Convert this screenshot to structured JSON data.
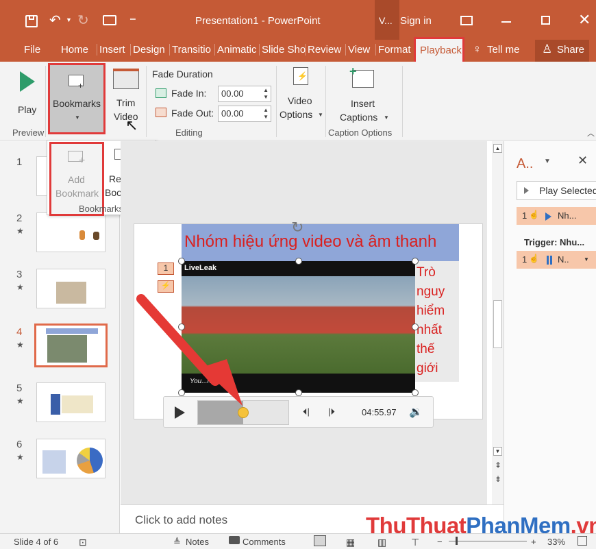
{
  "title_bar": {
    "doc_title": "Presentation1 - PowerPoint",
    "context_tab": "V...",
    "sign_in": "Sign in"
  },
  "tabs": [
    "File",
    "Home",
    "Insert",
    "Design",
    "Transitio",
    "Animatic",
    "Slide Sho",
    "Review",
    "View",
    "Format",
    "Playback"
  ],
  "tell_me": "Tell me",
  "share": "Share",
  "ribbon": {
    "preview": {
      "play_label": "Play",
      "group_label": "Preview"
    },
    "bookmarks_label": "Bookmarks",
    "trim": {
      "line1": "Trim",
      "line2": "Video"
    },
    "editing": {
      "fade_duration": "Fade Duration",
      "fade_in_label": "Fade In:",
      "fade_in_value": "00.00",
      "fade_out_label": "Fade Out:",
      "fade_out_value": "00.00",
      "group_label": "Editing"
    },
    "video_options": {
      "line1": "Video",
      "line2": "Options"
    },
    "insert_captions": {
      "line1": "Insert",
      "line2": "Captions"
    },
    "caption_group_label": "Caption Options"
  },
  "bookmark_menu": {
    "add_line1": "Add",
    "add_line2": "Bookmark",
    "remove_line1": "Remove",
    "remove_line2": "Bookmark",
    "group_label": "Bookmarks"
  },
  "slides": [
    {
      "num": "1",
      "star": ""
    },
    {
      "num": "2",
      "star": "★"
    },
    {
      "num": "3",
      "star": "★"
    },
    {
      "num": "4",
      "star": "★"
    },
    {
      "num": "5",
      "star": "★"
    },
    {
      "num": "6",
      "star": "★"
    }
  ],
  "slide": {
    "heading": "Nhóm hiệu ứng video và âm thanh",
    "side_text": [
      "Trò",
      "nguy",
      "hiểm",
      "nhất",
      "thế",
      "giới"
    ],
    "anim_tag_1": "1",
    "video_logo": "LiveLeak",
    "video_caption": "You...nVietTv"
  },
  "player": {
    "time": "04:55.97",
    "progress": 0.5
  },
  "anim_pane": {
    "title": "A..",
    "play_selected": "Play Selected",
    "item1_num": "1",
    "item1_text": "Nh...",
    "trigger": "Trigger: Nhu...",
    "item2_num": "1",
    "item2_text": "N.."
  },
  "notes_placeholder": "Click to add notes",
  "status": {
    "slide_info": "Slide 4 of 6",
    "notes": "Notes",
    "comments": "Comments",
    "zoom": "33%"
  },
  "watermark": {
    "part1": "ThuThuat",
    "part2": "PhanMem",
    "part3": ".vn"
  },
  "colors": {
    "accent": "#c55a36",
    "highlight": "#e03a3a",
    "slide_title": "#d9201f"
  }
}
